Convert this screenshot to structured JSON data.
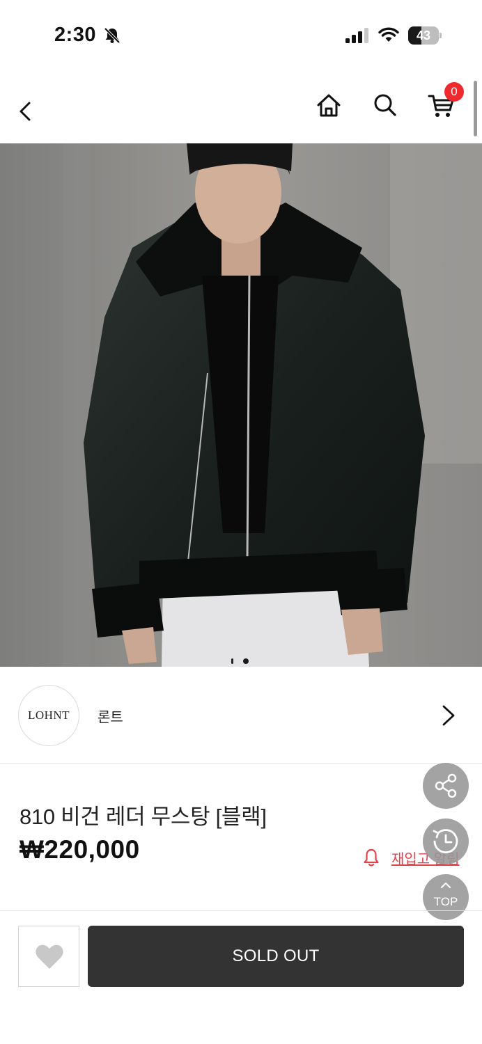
{
  "status_bar": {
    "time": "2:30",
    "battery": "43",
    "battery_level": 0.43,
    "icons": [
      "bell-slash-icon",
      "cellular-signal-icon",
      "wifi-icon",
      "battery-icon"
    ]
  },
  "header": {
    "icons": [
      "chevron-left-icon",
      "home-icon",
      "search-icon",
      "cart-icon"
    ],
    "cart_count": "0"
  },
  "hero": {
    "slide_count": 2,
    "active_slide": 2
  },
  "brand": {
    "logo_text": "LOHNT",
    "name": "론트"
  },
  "product": {
    "title": "810 비건 레더 무스탕 [블랙]",
    "price": "₩220,000"
  },
  "restock": {
    "label": "재입고 알림"
  },
  "floating": {
    "top_label": "TOP"
  },
  "actions": {
    "sold_out_label": "SOLD OUT"
  },
  "colors": {
    "accent_red": "#f0292e",
    "restock_red": "#e2424c",
    "button_dark": "#333333"
  }
}
